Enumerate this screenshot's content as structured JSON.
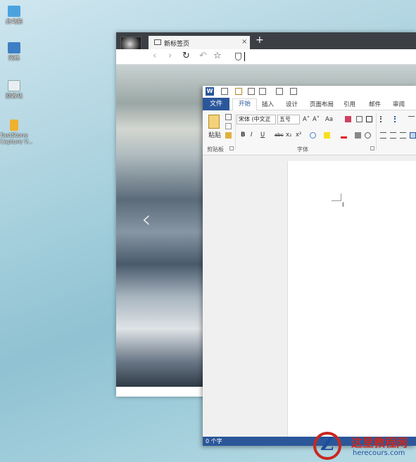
{
  "desktop": {
    "icons": [
      {
        "label": "此电脑",
        "icon": "computer-icon",
        "color": "#4aa3df"
      },
      {
        "label": "网络",
        "icon": "network-icon",
        "color": "#3d7fc4"
      },
      {
        "label": "回收站",
        "icon": "recycle-bin-icon",
        "color": "#e9eef2"
      },
      {
        "label": "FastStone\nCapture V...",
        "icon": "app-shortcut-icon",
        "color": "#f0b030"
      }
    ]
  },
  "browser": {
    "tab_title": "新标签页",
    "tab_close": "×",
    "new_tab": "+",
    "nav": {
      "back": "‹",
      "forward": "›",
      "reload": "↻",
      "undo": "↶",
      "favorite": "☆"
    },
    "content_arrow": "‹"
  },
  "word": {
    "logo": "W",
    "file_tab": "文件",
    "tabs": [
      "开始",
      "插入",
      "设计",
      "页面布局",
      "引用",
      "邮件",
      "审阅"
    ],
    "clipboard": {
      "paste": "粘贴",
      "label": "剪贴板"
    },
    "font": {
      "name": "宋体 (中文正",
      "size": "五号",
      "label": "字体"
    },
    "format_buttons": [
      "B",
      "I",
      "U",
      "abc",
      "x₂",
      "x²"
    ],
    "font_size_buttons": [
      "A˄",
      "A˅",
      "Aa"
    ],
    "status": "0 个字"
  },
  "watermark": {
    "title": "这里教程网",
    "url": "herecours.com"
  }
}
